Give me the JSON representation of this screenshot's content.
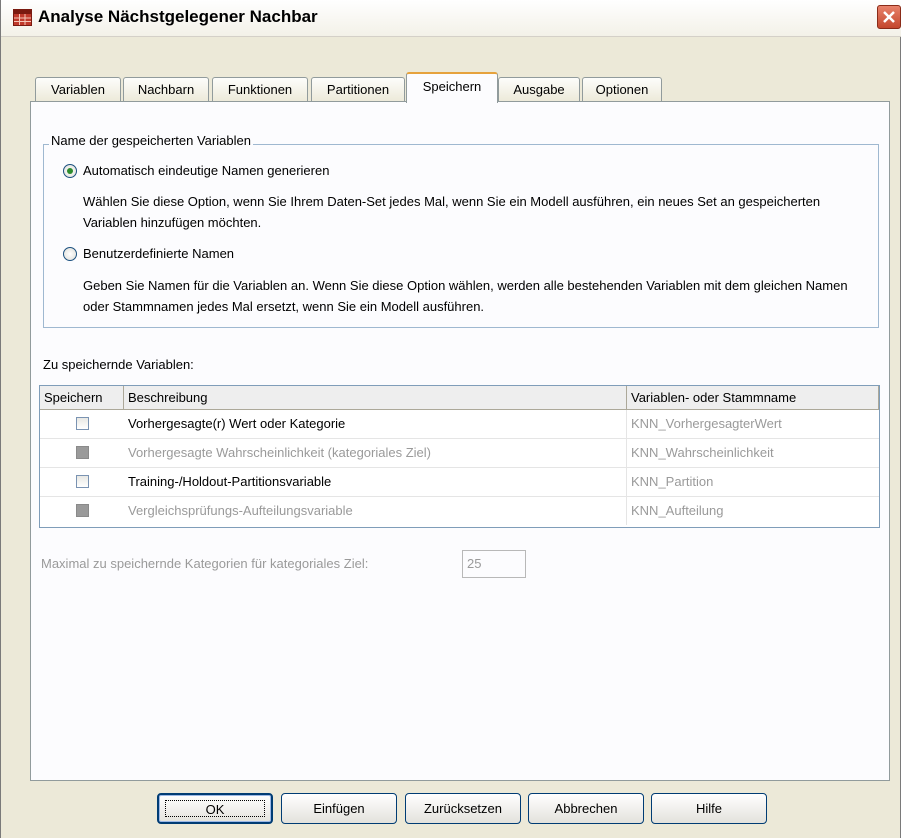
{
  "window": {
    "title": "Analyse Nächstgelegener Nachbar",
    "icon": "table-grid-icon",
    "close": "close-icon"
  },
  "tabs": [
    {
      "label": "Variablen",
      "active": false
    },
    {
      "label": "Nachbarn",
      "active": false
    },
    {
      "label": "Funktionen",
      "active": false
    },
    {
      "label": "Partitionen",
      "active": false
    },
    {
      "label": "Speichern",
      "active": true
    },
    {
      "label": "Ausgabe",
      "active": false
    },
    {
      "label": "Optionen",
      "active": false
    }
  ],
  "naming": {
    "legend": "Name der gespeicherten Variablen",
    "options": [
      {
        "label": "Automatisch eindeutige Namen generieren",
        "checked": true,
        "description": "Wählen Sie diese Option, wenn Sie Ihrem Daten-Set jedes Mal, wenn Sie ein Modell ausführen, ein neues Set an gespeicherten Variablen hinzufügen möchten."
      },
      {
        "label": "Benutzerdefinierte Namen",
        "checked": false,
        "description": "Geben Sie Namen für die Variablen an. Wenn Sie diese Option wählen, werden alle bestehenden Variablen mit dem gleichen Namen oder Stammnamen jedes Mal ersetzt, wenn Sie ein Modell ausführen."
      }
    ]
  },
  "variables": {
    "section_label": "Zu speichernde Variablen:",
    "columns": [
      "Speichern",
      "Beschreibung",
      "Variablen- oder Stammname"
    ],
    "rows": [
      {
        "checked": false,
        "enabled": true,
        "description": "Vorhergesagte(r) Wert oder Kategorie",
        "name": "KNN_VorhergesagterWert"
      },
      {
        "checked": false,
        "enabled": false,
        "description": "Vorhergesagte Wahrscheinlichkeit (kategoriales Ziel)",
        "name": "KNN_Wahrscheinlichkeit"
      },
      {
        "checked": false,
        "enabled": true,
        "description": "Training-/Holdout-Partitionsvariable",
        "name": "KNN_Partition"
      },
      {
        "checked": false,
        "enabled": false,
        "description": "Vergleichsprüfungs-Aufteilungsvariable",
        "name": "KNN_Aufteilung"
      }
    ]
  },
  "max_categories": {
    "label": "Maximal zu speichernde Kategorien für kategoriales Ziel:",
    "value": "25"
  },
  "buttons": {
    "ok": "OK",
    "insert": "Einfügen",
    "reset": "Zurücksetzen",
    "cancel": "Abbrechen",
    "help": "Hilfe"
  }
}
